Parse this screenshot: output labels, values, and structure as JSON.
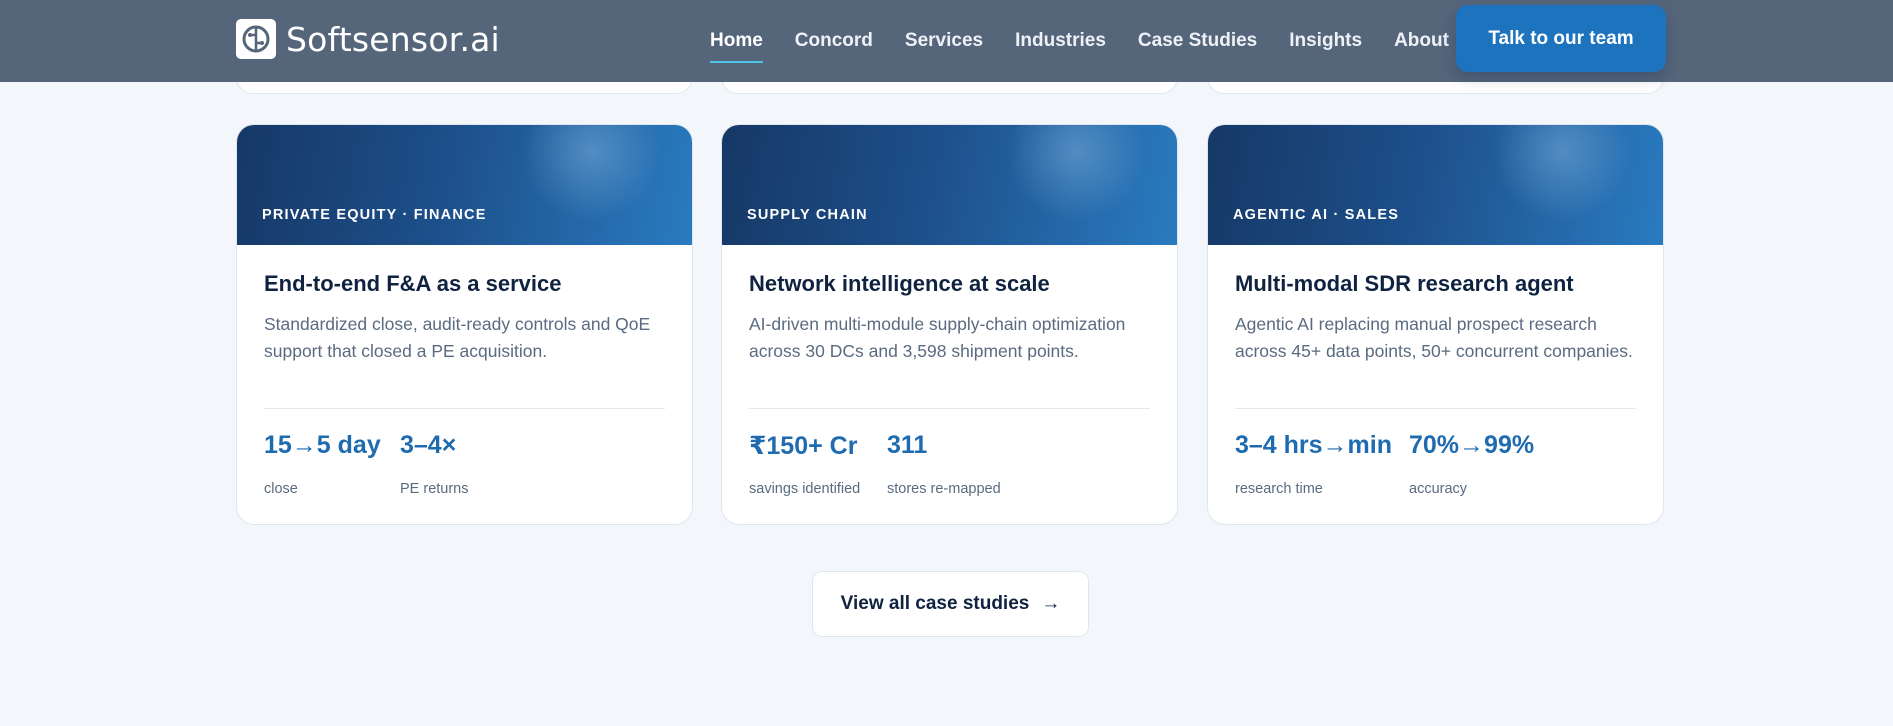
{
  "header": {
    "logo_text": "Softsensor.ai",
    "nav": [
      "Home",
      "Concord",
      "Services",
      "Industries",
      "Case Studies",
      "Insights",
      "About"
    ],
    "active_nav": "Home",
    "cta_label": "Talk to our team"
  },
  "cards": [
    {
      "tag": "PRIVATE EQUITY · FINANCE",
      "title": "End-to-end F&A as a service",
      "description": "Standardized close, audit-ready controls and QoE support that closed a PE acquisition.",
      "stats": [
        {
          "value": "15→5 day",
          "label": "close"
        },
        {
          "value": "3–4×",
          "label": "PE returns"
        }
      ]
    },
    {
      "tag": "SUPPLY CHAIN",
      "title": "Network intelligence at scale",
      "description": "AI-driven multi-module supply-chain optimization across 30 DCs and 3,598 shipment points.",
      "stats": [
        {
          "value": "₹150+ Cr",
          "label": "savings identified"
        },
        {
          "value": "311",
          "label": "stores re-mapped"
        }
      ]
    },
    {
      "tag": "AGENTIC AI · SALES",
      "title": "Multi-modal SDR research agent",
      "description": "Agentic AI replacing manual prospect research across 45+ data points, 50+ concurrent companies.",
      "stats": [
        {
          "value": "3–4 hrs→min",
          "label": "research time"
        },
        {
          "value": "70%→99%",
          "label": "accuracy"
        }
      ]
    }
  ],
  "view_all": {
    "label": "View all case studies",
    "arrow": "→"
  },
  "colors": {
    "header_bg": "#55657a",
    "accent": "#1e73be",
    "stat_value": "#1e6bb0",
    "nav_active_underline": "#4fc3e8"
  }
}
